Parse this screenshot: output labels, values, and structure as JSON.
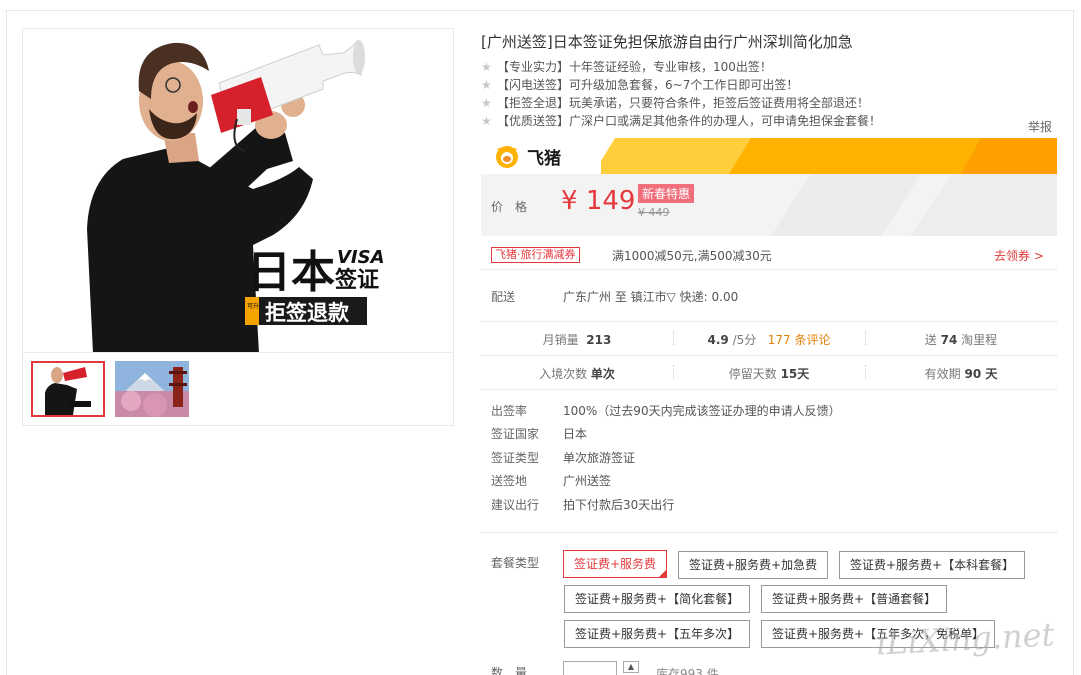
{
  "product": {
    "title": "[广州送签]日本签证免担保旅游自由行广州深圳简化加急",
    "features": [
      "【专业实力】十年签证经验，专业审核，100出签！",
      "【闪电送签】可升级加急套餐，6~7个工作日即可出签！",
      "【拒签全退】玩美承诺，只要符合条件，拒签后签证费用将全部退还！",
      "【优质送签】广深户口或满足其他条件的办理人，可申请免担保金套餐！"
    ],
    "report_label": "举报"
  },
  "hero": {
    "title_main": "日本",
    "visa_en": "VISA",
    "visa_cn": "签证",
    "badge_small": "可升级",
    "refund": "拒签退款"
  },
  "brand": {
    "name": "飞猪"
  },
  "price": {
    "label": "价格",
    "currency": "¥",
    "value": "149",
    "promo_tag": "新春特惠",
    "old_price": "¥ 449"
  },
  "coupon": {
    "tag": "飞猪·旅行满减券",
    "text": "满1000减50元,满500减30元",
    "link": "去领券 >"
  },
  "shipping": {
    "label": "配送",
    "value": "广东广州 至 镇江市▽   快递: 0.00"
  },
  "stats": {
    "monthly_label": "月销量",
    "monthly_value": "213",
    "rating": "4.9",
    "rating_suffix": "/5分",
    "reviews": "177 条评论",
    "points_label": "送",
    "points_value": "74",
    "points_suffix": "淘里程",
    "entries_label": "入境次数",
    "entries_value": "单次",
    "stay_label": "停留天数",
    "stay_value": "15天",
    "validity_label": "有效期",
    "validity_value": "90 天"
  },
  "visa_info": [
    {
      "k": "出签率",
      "v": "100%（过去90天内完成该签证办理的申请人反馈）"
    },
    {
      "k": "签证国家",
      "v": "日本"
    },
    {
      "k": "签证类型",
      "v": "单次旅游签证"
    },
    {
      "k": "送签地",
      "v": "广州送签"
    },
    {
      "k": "建议出行",
      "v": "拍下付款后30天出行"
    }
  ],
  "packages": {
    "label": "套餐类型",
    "options": [
      "签证费+服务费",
      "签证费+服务费+加急费",
      "签证费+服务费+【本科套餐】",
      "签证费+服务费+【简化套餐】",
      "签证费+服务费+【普通套餐】",
      "签证费+服务费+【五年多次】",
      "签证费+服务费+【五年多次，免税单】"
    ]
  },
  "quantity": {
    "label": "数量",
    "stock": "库存993 件"
  },
  "watermark": "iLiXing.net",
  "colors": {
    "accent": "#e4393c",
    "brand": "#ffb200",
    "orange": "#e5820a"
  }
}
